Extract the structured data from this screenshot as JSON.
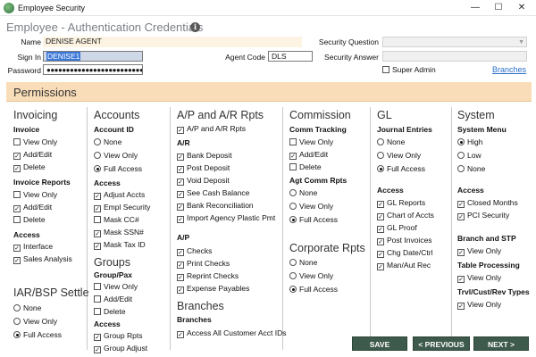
{
  "window": {
    "title": "Employee Security",
    "minimize": "—",
    "maximize": "☐",
    "close": "✕"
  },
  "header": {
    "title": "Employee - Authentication Credentials",
    "info": "i"
  },
  "form": {
    "name_label": "Name",
    "name_value": "DENISE AGENT",
    "signin_label": "Sign In",
    "signin_value": "DENISE1",
    "password_label": "Password",
    "password_value": "●●●●●●●●●●●●●●●●●●●●●●●●●●●",
    "agent_code_label": "Agent Code",
    "agent_code_value": "DLS",
    "security_question_label": "Security Question",
    "security_question_value": "",
    "security_answer_label": "Security Answer",
    "security_answer_value": "",
    "super_admin_label": "Super Admin",
    "super_admin_checked": false,
    "branches_link": "Branches"
  },
  "permissions": {
    "title": "Permissions",
    "invoicing": {
      "title": "Invoicing",
      "invoice": {
        "title": "Invoice",
        "view_only": "View Only",
        "add_edit": "Add/Edit",
        "delete": "Delete"
      },
      "invoice_reports": {
        "title": "Invoice Reports",
        "view_only": "View Only",
        "add_edit": "Add/Edit",
        "delete": "Delete"
      },
      "access": {
        "title": "Access",
        "interface": "Interface",
        "sales_analysis": "Sales Analysis"
      }
    },
    "iar_bsp": {
      "title": "IAR/BSP Settle",
      "none": "None",
      "view_only": "View Only",
      "full_access": "Full Access"
    },
    "accounts": {
      "title": "Accounts",
      "account_id": {
        "title": "Account ID",
        "none": "None",
        "view_only": "View Only",
        "full_access": "Full Access"
      },
      "access": {
        "title": "Access",
        "adjust_accts": "Adjust Accts",
        "empl_security": "Empl Security",
        "mask_cc": "Mask CC#",
        "mask_ssn": "Mask SSN#",
        "mask_tax": "Mask Tax ID"
      }
    },
    "groups": {
      "title": "Groups",
      "group_pax": {
        "title": "Group/Pax",
        "view_only": "View Only",
        "add_edit": "Add/Edit",
        "delete": "Delete"
      },
      "access": {
        "title": "Access",
        "group_rpts": "Group Rpts",
        "group_adjust": "Group Adjust"
      }
    },
    "ap_ar": {
      "title": "A/P and A/R Rpts",
      "top": "A/P and A/R Rpts",
      "ar": {
        "title": "A/R",
        "bank_deposit": "Bank Deposit",
        "post_deposit": "Post Deposit",
        "void_deposit": "Void Deposit",
        "see_cash_balance": "See Cash Balance",
        "bank_reconciliation": "Bank Reconciliation",
        "import_agency": "Import Agency Plastic Pmt"
      },
      "ap": {
        "title": "A/P",
        "checks": "Checks",
        "print_checks": "Print Checks",
        "reprint_checks": "Reprint Checks",
        "expense_payables": "Expense Payables"
      }
    },
    "branches": {
      "title": "Branches",
      "sub": "Branches",
      "access_all": "Access All Customer Acct IDs"
    },
    "commission": {
      "title": "Commission",
      "comm_tracking": {
        "title": "Comm Tracking",
        "view_only": "View Only",
        "add_edit": "Add/Edit",
        "delete": "Delete"
      },
      "agt_comm_rpts": {
        "title": "Agt Comm Rpts",
        "none": "None",
        "view_only": "View Only",
        "full_access": "Full Access"
      }
    },
    "corporate_rpts": {
      "title": "Corporate Rpts",
      "none": "None",
      "view_only": "View Only",
      "full_access": "Full Access"
    },
    "gl": {
      "title": "GL",
      "journal_entries": {
        "title": "Journal Entries",
        "none": "None",
        "view_only": "View Only",
        "full_access": "Full Access"
      },
      "access": {
        "title": "Access",
        "gl_reports": "GL Reports",
        "chart_of_accts": "Chart of Accts",
        "gl_proof": "GL Proof",
        "post_invoices": "Post Invoices",
        "chg_date_ctrl": "Chg Date/Ctrl",
        "man_aut_rec": "Man/Aut Rec"
      }
    },
    "system": {
      "title": "System",
      "system_menu": {
        "title": "System Menu",
        "high": "High",
        "low": "Low",
        "none": "None"
      },
      "access": {
        "title": "Access",
        "closed_months": "Closed Months",
        "pci_security": "PCI Security"
      },
      "branch_stp": {
        "title": "Branch and STP",
        "view_only": "View Only"
      },
      "table_processing": {
        "title": "Table Processing",
        "view_only": "View Only"
      },
      "trvl_cust_rev": {
        "title": "Trvl/Cust/Rev Types",
        "view_only": "View Only"
      }
    }
  },
  "buttons": {
    "save": "SAVE",
    "previous": "< PREVIOUS",
    "next": "NEXT >"
  },
  "colors": {
    "permissions_band": "#f8ddb8",
    "button_bg": "#3d5a4c",
    "link": "#2a6fc9",
    "selection": "#3b78d8"
  }
}
